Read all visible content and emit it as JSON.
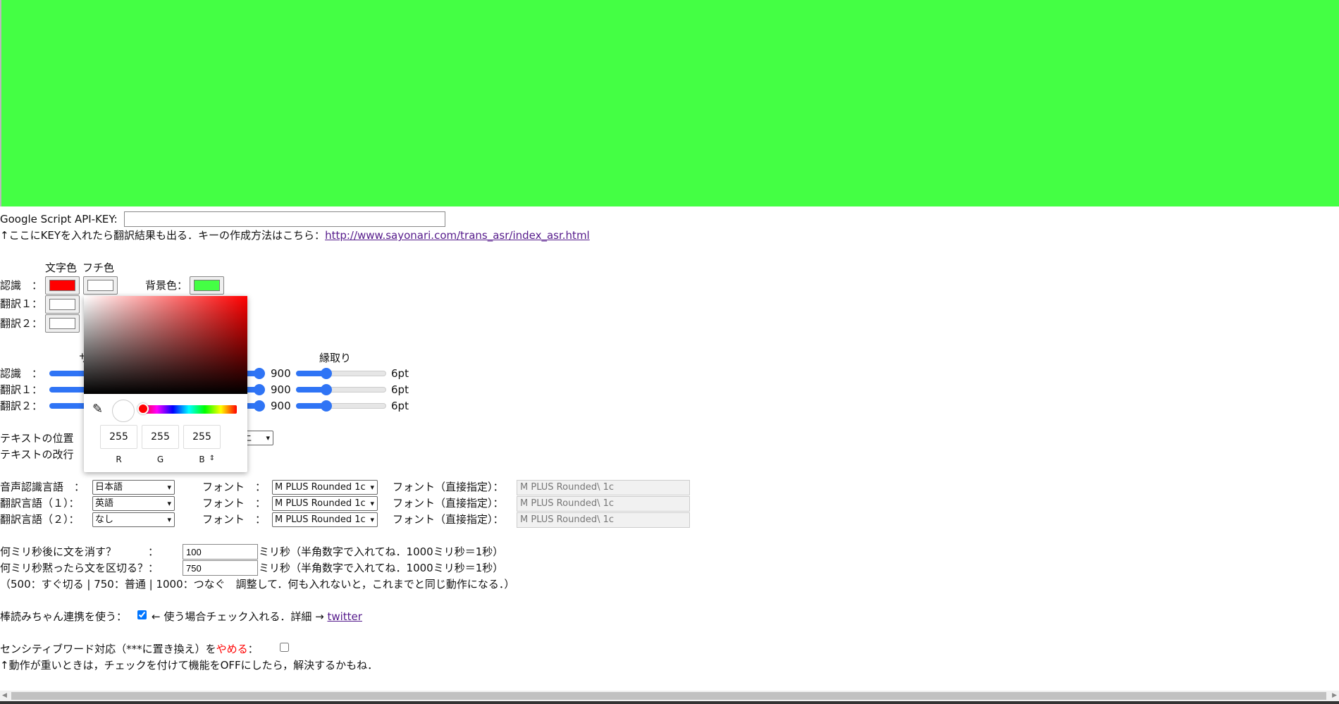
{
  "colors": {
    "stage_bg": "#44ff44",
    "recognition_text": "#ff0000",
    "accent": "#2f74f5",
    "warn": "#ff0000"
  },
  "api": {
    "label": "Google Script API-KEY:",
    "value": "",
    "note": "↑ここにKEYを入れたら翻訳結果も出る．キーの作成方法はこちら：",
    "link": "http://www.sayonari.com/trans_asr/index_asr.html"
  },
  "color_section": {
    "text_color_header": "文字色",
    "edge_color_header": "フチ色",
    "bg_label": "背景色：",
    "rows": [
      {
        "label": "認識　："
      },
      {
        "label": "翻訳１："
      },
      {
        "label": "翻訳２："
      }
    ]
  },
  "slider_section": {
    "size_header_partial": "サ",
    "edge_header": "縁取り",
    "rows": [
      {
        "label": "認識　：",
        "weight": "900",
        "edge": "6pt"
      },
      {
        "label": "翻訳１：",
        "weight": "900",
        "edge": "6pt"
      },
      {
        "label": "翻訳２：",
        "weight": "900",
        "edge": "6pt"
      }
    ]
  },
  "text_position": {
    "label": "テキストの位置",
    "value": "上"
  },
  "text_newline": {
    "label": "テキストの改行"
  },
  "color_picker": {
    "r": "255",
    "g": "255",
    "b": "255",
    "r_label": "R",
    "g_label": "G",
    "b_label": "B",
    "toggle": "⇕"
  },
  "languages": [
    {
      "label": "音声認識言語　：",
      "lang": "日本語",
      "font_label": "フォント　：",
      "font": "M PLUS Rounded 1c",
      "direct_label": "フォント（直接指定）：",
      "direct": "M PLUS Rounded\\ 1c"
    },
    {
      "label": "翻訳言語（１）：",
      "lang": "英語",
      "font_label": "フォント　：",
      "font": "M PLUS Rounded 1c",
      "direct_label": "フォント（直接指定）：",
      "direct": "M PLUS Rounded\\ 1c"
    },
    {
      "label": "翻訳言語（２）：",
      "lang": "なし",
      "font_label": "フォント　：",
      "font": "M PLUS Rounded 1c",
      "direct_label": "フォント（直接指定）：",
      "direct": "M PLUS Rounded\\ 1c"
    }
  ],
  "timing": {
    "erase_label": "何ミリ秒後に文を消す？　　　：",
    "erase_value": "100",
    "split_label": "何ミリ秒黙ったら文を区切る？：",
    "split_value": "750",
    "unit_note": "ミリ秒（半角数字で入れてね．1000ミリ秒＝1秒）",
    "hint": "（500：すぐ切る | 750：普通 | 1000：つなぐ　調整して．何も入れないと，これまでと同じ動作になる．）"
  },
  "bouyomi": {
    "label": "棒読みちゃん連携を使う：",
    "checked": true,
    "note": "← 使う場合チェック入れる．詳細 →",
    "link": "twitter"
  },
  "sensitive": {
    "label_a": "センシティブワード対応（***に置き換え）を",
    "label_b": "やめる",
    "label_c": "：",
    "checked": false,
    "note": "↑動作が重いときは，チェックを付けて機能をOFFにしたら，解決するかもね．"
  }
}
